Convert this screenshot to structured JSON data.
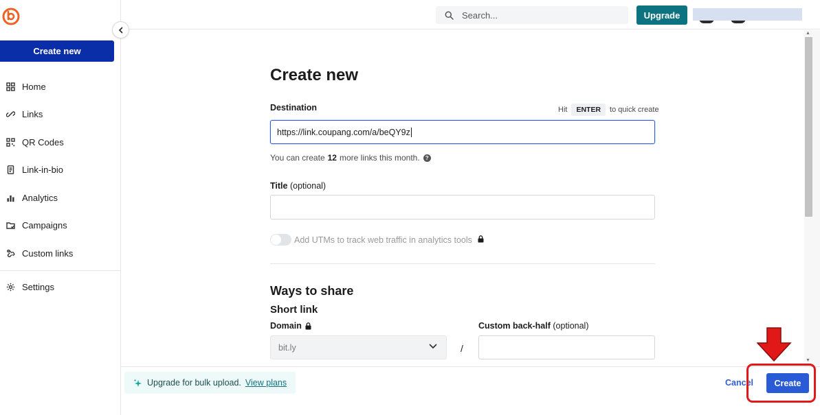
{
  "app": {
    "logo_icon": "bitly-logo-icon",
    "brand_color": "#ee6123"
  },
  "sidebar": {
    "create_new_label": "Create new",
    "collapse_icon": "chevron-left-icon",
    "items": [
      {
        "label": "Home",
        "icon": "grid-icon"
      },
      {
        "label": "Links",
        "icon": "link-icon"
      },
      {
        "label": "QR Codes",
        "icon": "qr-code-icon"
      },
      {
        "label": "Link-in-bio",
        "icon": "document-icon"
      },
      {
        "label": "Analytics",
        "icon": "bar-chart-icon"
      },
      {
        "label": "Campaigns",
        "icon": "campaign-icon"
      },
      {
        "label": "Custom links",
        "icon": "custom-link-icon"
      }
    ],
    "settings_label": "Settings"
  },
  "topbar": {
    "search_placeholder": "Search...",
    "upgrade_label": "Upgrade",
    "upgrade_color": "#0e7380"
  },
  "form": {
    "title": "Create new",
    "destination_label": "Destination",
    "hint_prefix": "Hit",
    "hint_key": "ENTER",
    "hint_suffix": "to quick create",
    "destination_value": "https://link.coupang.com/a/beQY9z",
    "limit_prefix": "You can create",
    "limit_count": "12",
    "limit_suffix": "more links this month.",
    "title_label": "Title",
    "title_optional": "(optional)",
    "title_value": "",
    "utm_label": "Add UTMs to track web traffic in analytics tools",
    "utm_enabled": false,
    "ways_to_share": "Ways to share",
    "short_link": "Short link",
    "domain_label": "Domain",
    "domain_value": "bit.ly",
    "slash": "/",
    "backhalf_label": "Custom back-half",
    "backhalf_optional": "(optional)",
    "backhalf_value": ""
  },
  "footer": {
    "bulk_text": "Upgrade for bulk upload.",
    "bulk_link": "View plans",
    "cancel_label": "Cancel",
    "create_label": "Create",
    "create_color": "#2a5bd7"
  },
  "annotation": {
    "highlight_color": "#e01818"
  }
}
